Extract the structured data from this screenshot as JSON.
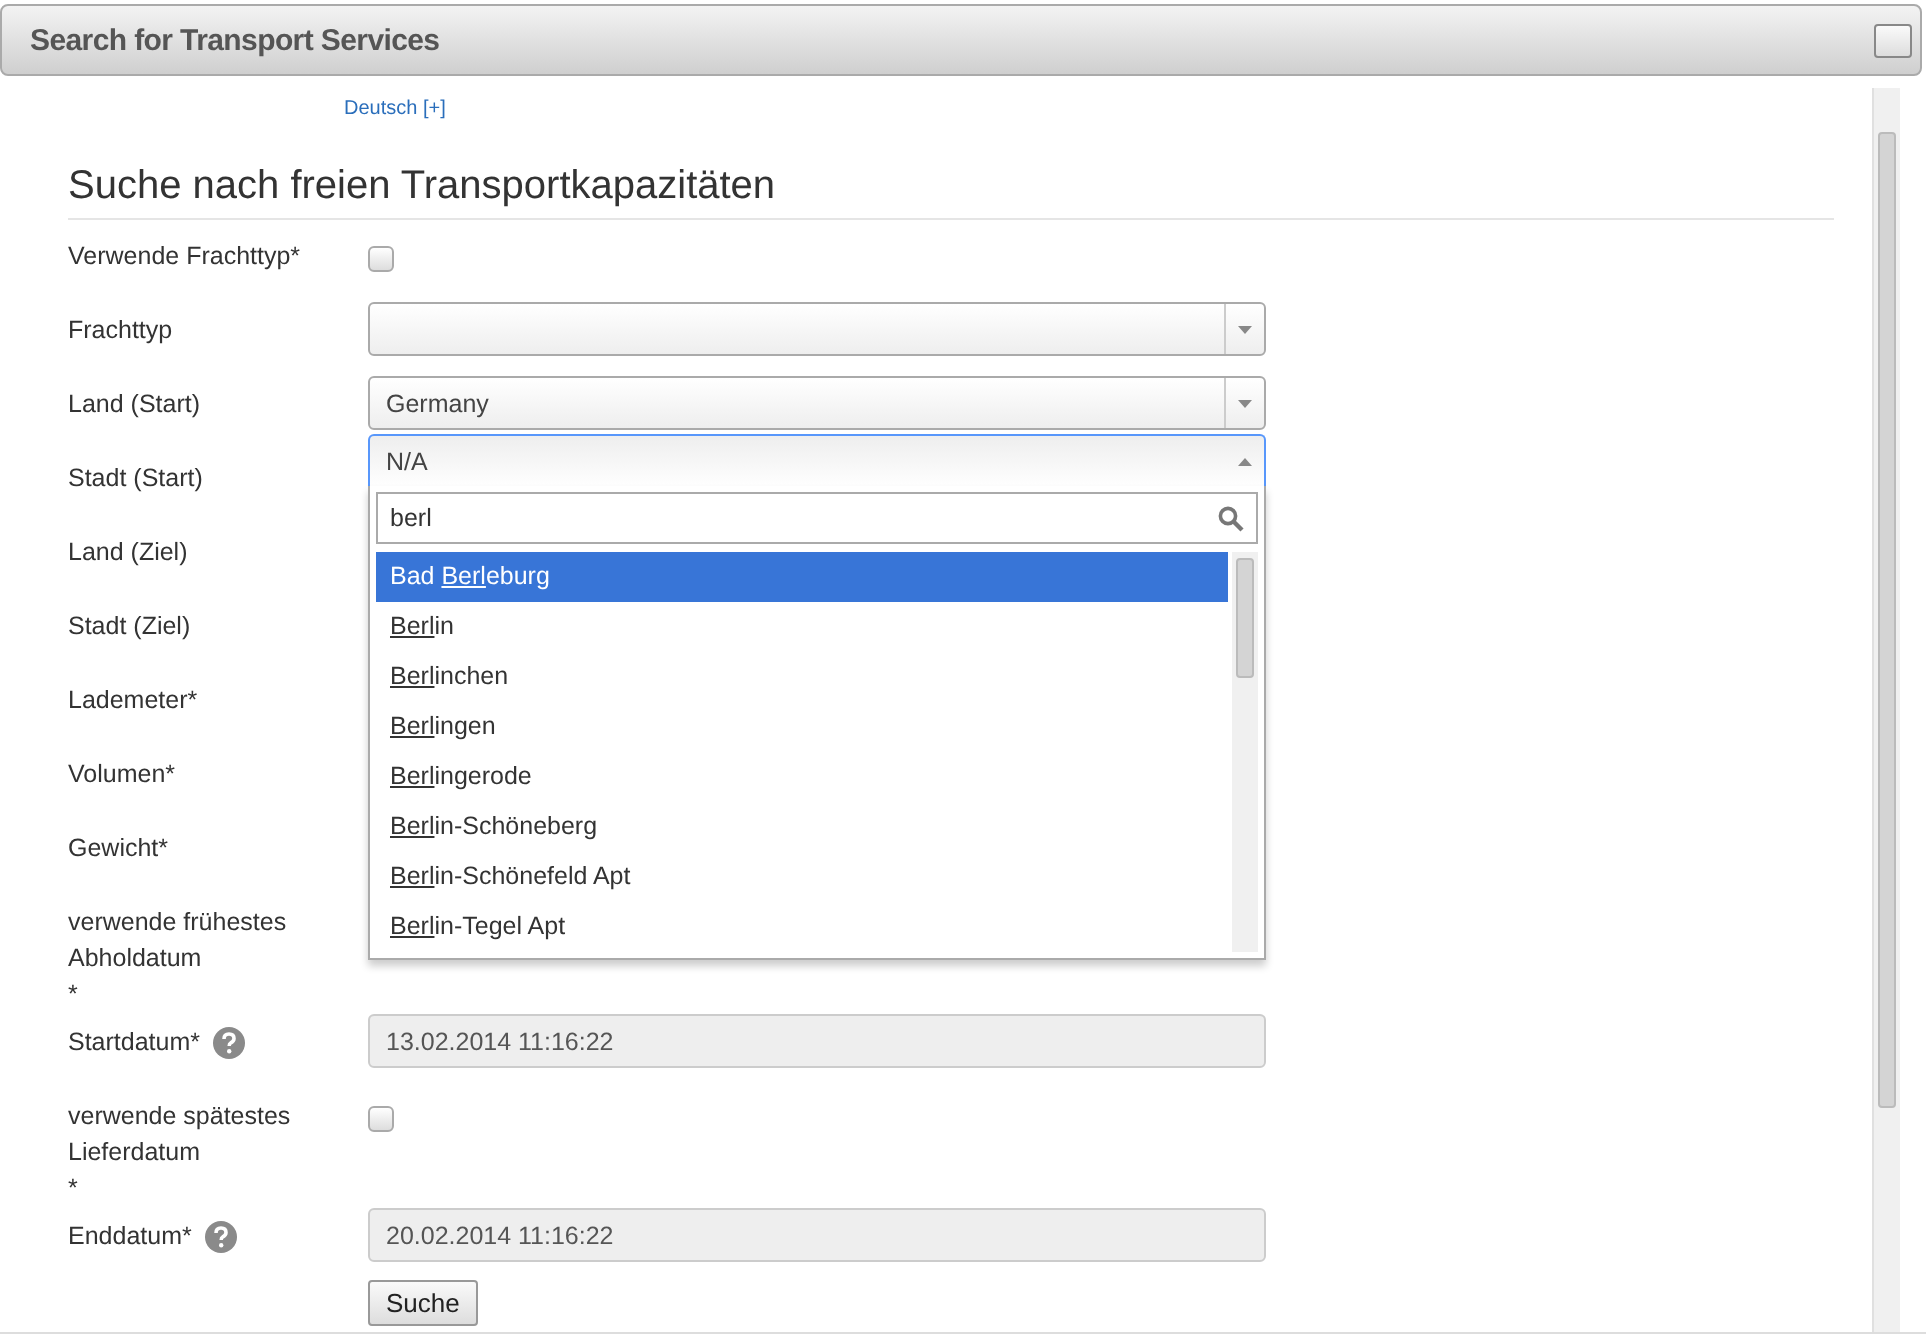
{
  "window": {
    "title": "Search for Transport Services"
  },
  "language_link": "Deutsch [+]",
  "heading": "Suche nach freien Transportkapazitäten",
  "rows": [
    {
      "kind": "checkbox",
      "label": "Verwende Frachttyp*",
      "checked": false
    },
    {
      "kind": "select",
      "label": "Frachttyp",
      "value": ""
    },
    {
      "kind": "select",
      "label": "Land (Start)",
      "value": "Germany"
    },
    {
      "kind": "combo",
      "label": "Stadt (Start)",
      "value": "N/A",
      "search": "berl",
      "results": [
        {
          "before": "Bad ",
          "match": "Berl",
          "after": "eburg",
          "selected": true
        },
        {
          "match": "Berl",
          "after": "in",
          "selected": false
        },
        {
          "match": "Berl",
          "after": "inchen",
          "selected": false
        },
        {
          "match": "Berl",
          "after": "ingen",
          "selected": false
        },
        {
          "match": "Berl",
          "after": "ingerode",
          "selected": false
        },
        {
          "match": "Berl",
          "after": "in-Schöneberg",
          "selected": false
        },
        {
          "match": "Berl",
          "after": "in-Schönefeld Apt",
          "selected": false
        },
        {
          "match": "Berl",
          "after": "in-Tegel Apt",
          "selected": false
        }
      ]
    },
    {
      "kind": "covered",
      "label": "Land (Ziel)"
    },
    {
      "kind": "covered",
      "label": "Stadt (Ziel)"
    },
    {
      "kind": "covered",
      "label": "Lademeter*"
    },
    {
      "kind": "covered",
      "label": "Volumen*"
    },
    {
      "kind": "covered",
      "label": "Gewicht*"
    },
    {
      "kind": "covered",
      "label": "verwende frühestes Abholdatum",
      "mark": "*"
    },
    {
      "kind": "date",
      "label": "Startdatum*",
      "value": "13.02.2014 11:16:22",
      "help": true
    },
    {
      "kind": "checkbox",
      "label": "verwende spätestes Lieferdatum",
      "mark": "*",
      "checked": false
    },
    {
      "kind": "date",
      "label": "Enddatum*",
      "value": "20.02.2014 11:16:22",
      "help": true
    },
    {
      "kind": "button",
      "label": "Suche"
    }
  ]
}
